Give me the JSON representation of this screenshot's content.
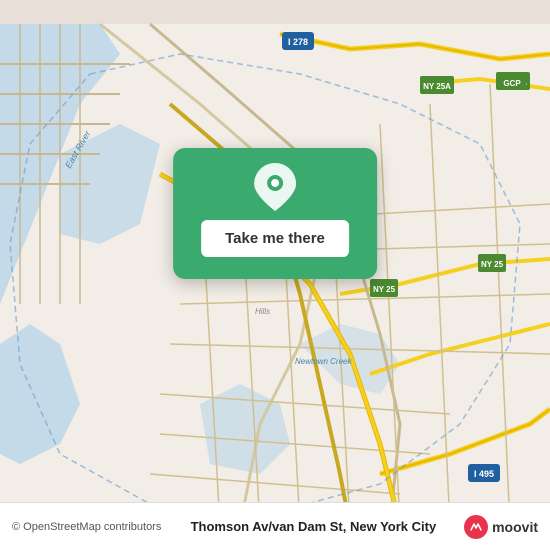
{
  "map": {
    "alt": "Map of Thomson Av/van Dam St, New York City",
    "background_color": "#e8e0d8"
  },
  "popup": {
    "button_label": "Take me there",
    "pin_icon": "location-pin"
  },
  "bottom_bar": {
    "copyright": "© OpenStreetMap contributors",
    "location_title": "Thomson Av/van Dam St, New York City",
    "logo_text": "moovit"
  }
}
